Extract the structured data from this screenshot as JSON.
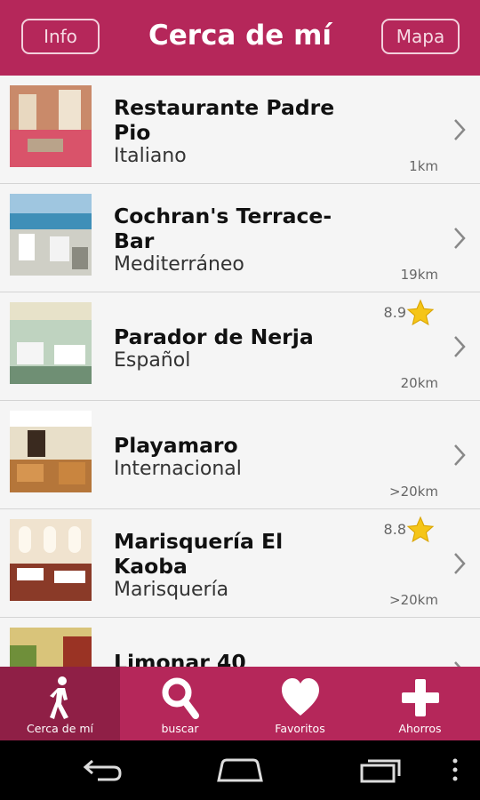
{
  "header": {
    "info_label": "Info",
    "title": "Cerca de mí",
    "map_label": "Mapa"
  },
  "restaurants": [
    {
      "name_line1": "Restaurante Padre",
      "name_line2": "Pio",
      "cuisine": "Italiano",
      "distance": "1km",
      "rating": ""
    },
    {
      "name_line1": "Cochran's Terrace-",
      "name_line2": "Bar",
      "cuisine": "Mediterráneo",
      "distance": "19km",
      "rating": ""
    },
    {
      "name_line1": "Parador de Nerja",
      "name_line2": "",
      "cuisine": "Español",
      "distance": "20km",
      "rating": "8.9"
    },
    {
      "name_line1": "Playamaro",
      "name_line2": "",
      "cuisine": "Internacional",
      "distance": ">20km",
      "rating": ""
    },
    {
      "name_line1": "Marisquería El",
      "name_line2": "Kaoba",
      "cuisine": "Marisquería",
      "distance": ">20km",
      "rating": "8.8"
    },
    {
      "name_line1": "Limonar 40",
      "name_line2": "",
      "cuisine": "",
      "distance": "",
      "rating": ""
    }
  ],
  "tabs": [
    {
      "label": "Cerca de mí",
      "icon": "walking-person-icon",
      "active": true
    },
    {
      "label": "buscar",
      "icon": "search-icon",
      "active": false
    },
    {
      "label": "Favoritos",
      "icon": "heart-icon",
      "active": false
    },
    {
      "label": "Ahorros",
      "icon": "plus-icon",
      "active": false
    }
  ],
  "colors": {
    "brand": "#b5275a",
    "brand_dark": "#8f1f46",
    "star": "#f5c518"
  }
}
